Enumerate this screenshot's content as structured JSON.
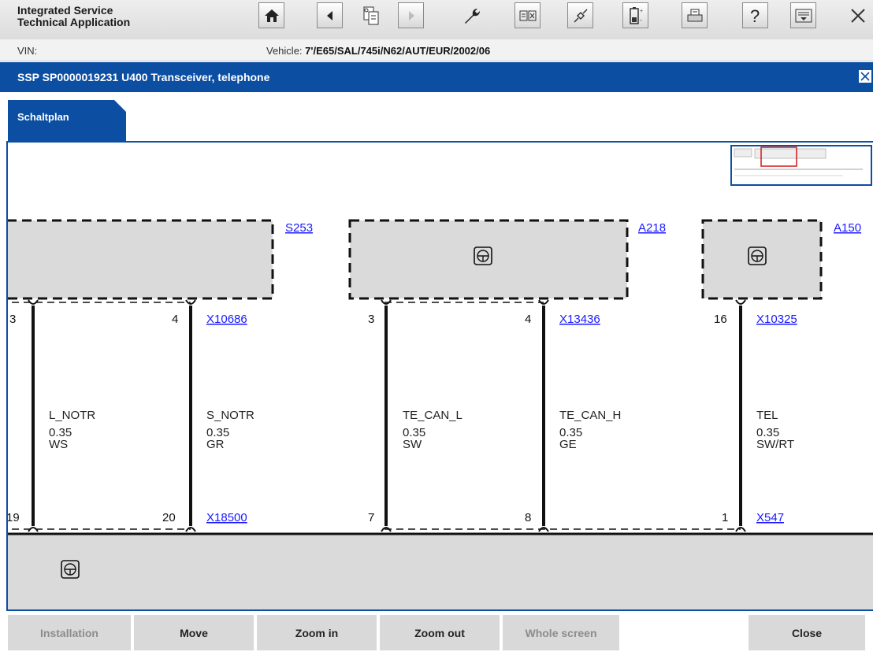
{
  "app": {
    "title_line1": "Integrated Service",
    "title_line2": "Technical Application"
  },
  "toolbar": [
    {
      "name": "home-icon",
      "disabled": false
    },
    {
      "name": "back-icon",
      "disabled": false
    },
    {
      "name": "document-icon",
      "disabled": false
    },
    {
      "name": "forward-icon",
      "disabled": true
    },
    {
      "name": "wrench-icon",
      "disabled": false
    },
    {
      "name": "split-view-icon",
      "disabled": false
    },
    {
      "name": "plug-icon",
      "disabled": false
    },
    {
      "name": "battery-icon",
      "disabled": false
    },
    {
      "name": "printer-icon",
      "disabled": false
    },
    {
      "name": "help-icon",
      "disabled": false
    },
    {
      "name": "panel-icon",
      "disabled": false
    },
    {
      "name": "close-icon",
      "disabled": false
    }
  ],
  "info": {
    "vin_label": "VIN:",
    "vehicle_label": "Vehicle:",
    "vehicle_value": "7'/E65/SAL/745i/N62/AUT/EUR/2002/06"
  },
  "doc_title": "SSP SP0000019231 U400 Transceiver, telephone",
  "tab_label": "Schaltplan",
  "diagram": {
    "components": [
      "S253",
      "A218",
      "A150"
    ],
    "connectors_top": [
      "X10686",
      "X13436",
      "X10325"
    ],
    "connectors_bottom": [
      "X18500",
      "X547"
    ],
    "pins_top": [
      "3",
      "4",
      "3",
      "4",
      "16"
    ],
    "pins_bottom": [
      "19",
      "20",
      "7",
      "8",
      "1"
    ],
    "wires": [
      {
        "signal": "L_NOTR",
        "size": "0.35",
        "color": "WS"
      },
      {
        "signal": "S_NOTR",
        "size": "0.35",
        "color": "GR"
      },
      {
        "signal": "TE_CAN_L",
        "size": "0.35",
        "color": "SW"
      },
      {
        "signal": "TE_CAN_H",
        "size": "0.35",
        "color": "GE"
      },
      {
        "signal": "TEL",
        "size": "0.35",
        "color": "SW/RT"
      }
    ]
  },
  "footer": {
    "installation": "Installation",
    "move": "Move",
    "zoom_in": "Zoom in",
    "zoom_out": "Zoom out",
    "whole_screen": "Whole screen",
    "close": "Close"
  },
  "colors": {
    "brand_blue": "#0b4ea2",
    "link": "#1a1aff",
    "panel_grey": "#dadada"
  }
}
